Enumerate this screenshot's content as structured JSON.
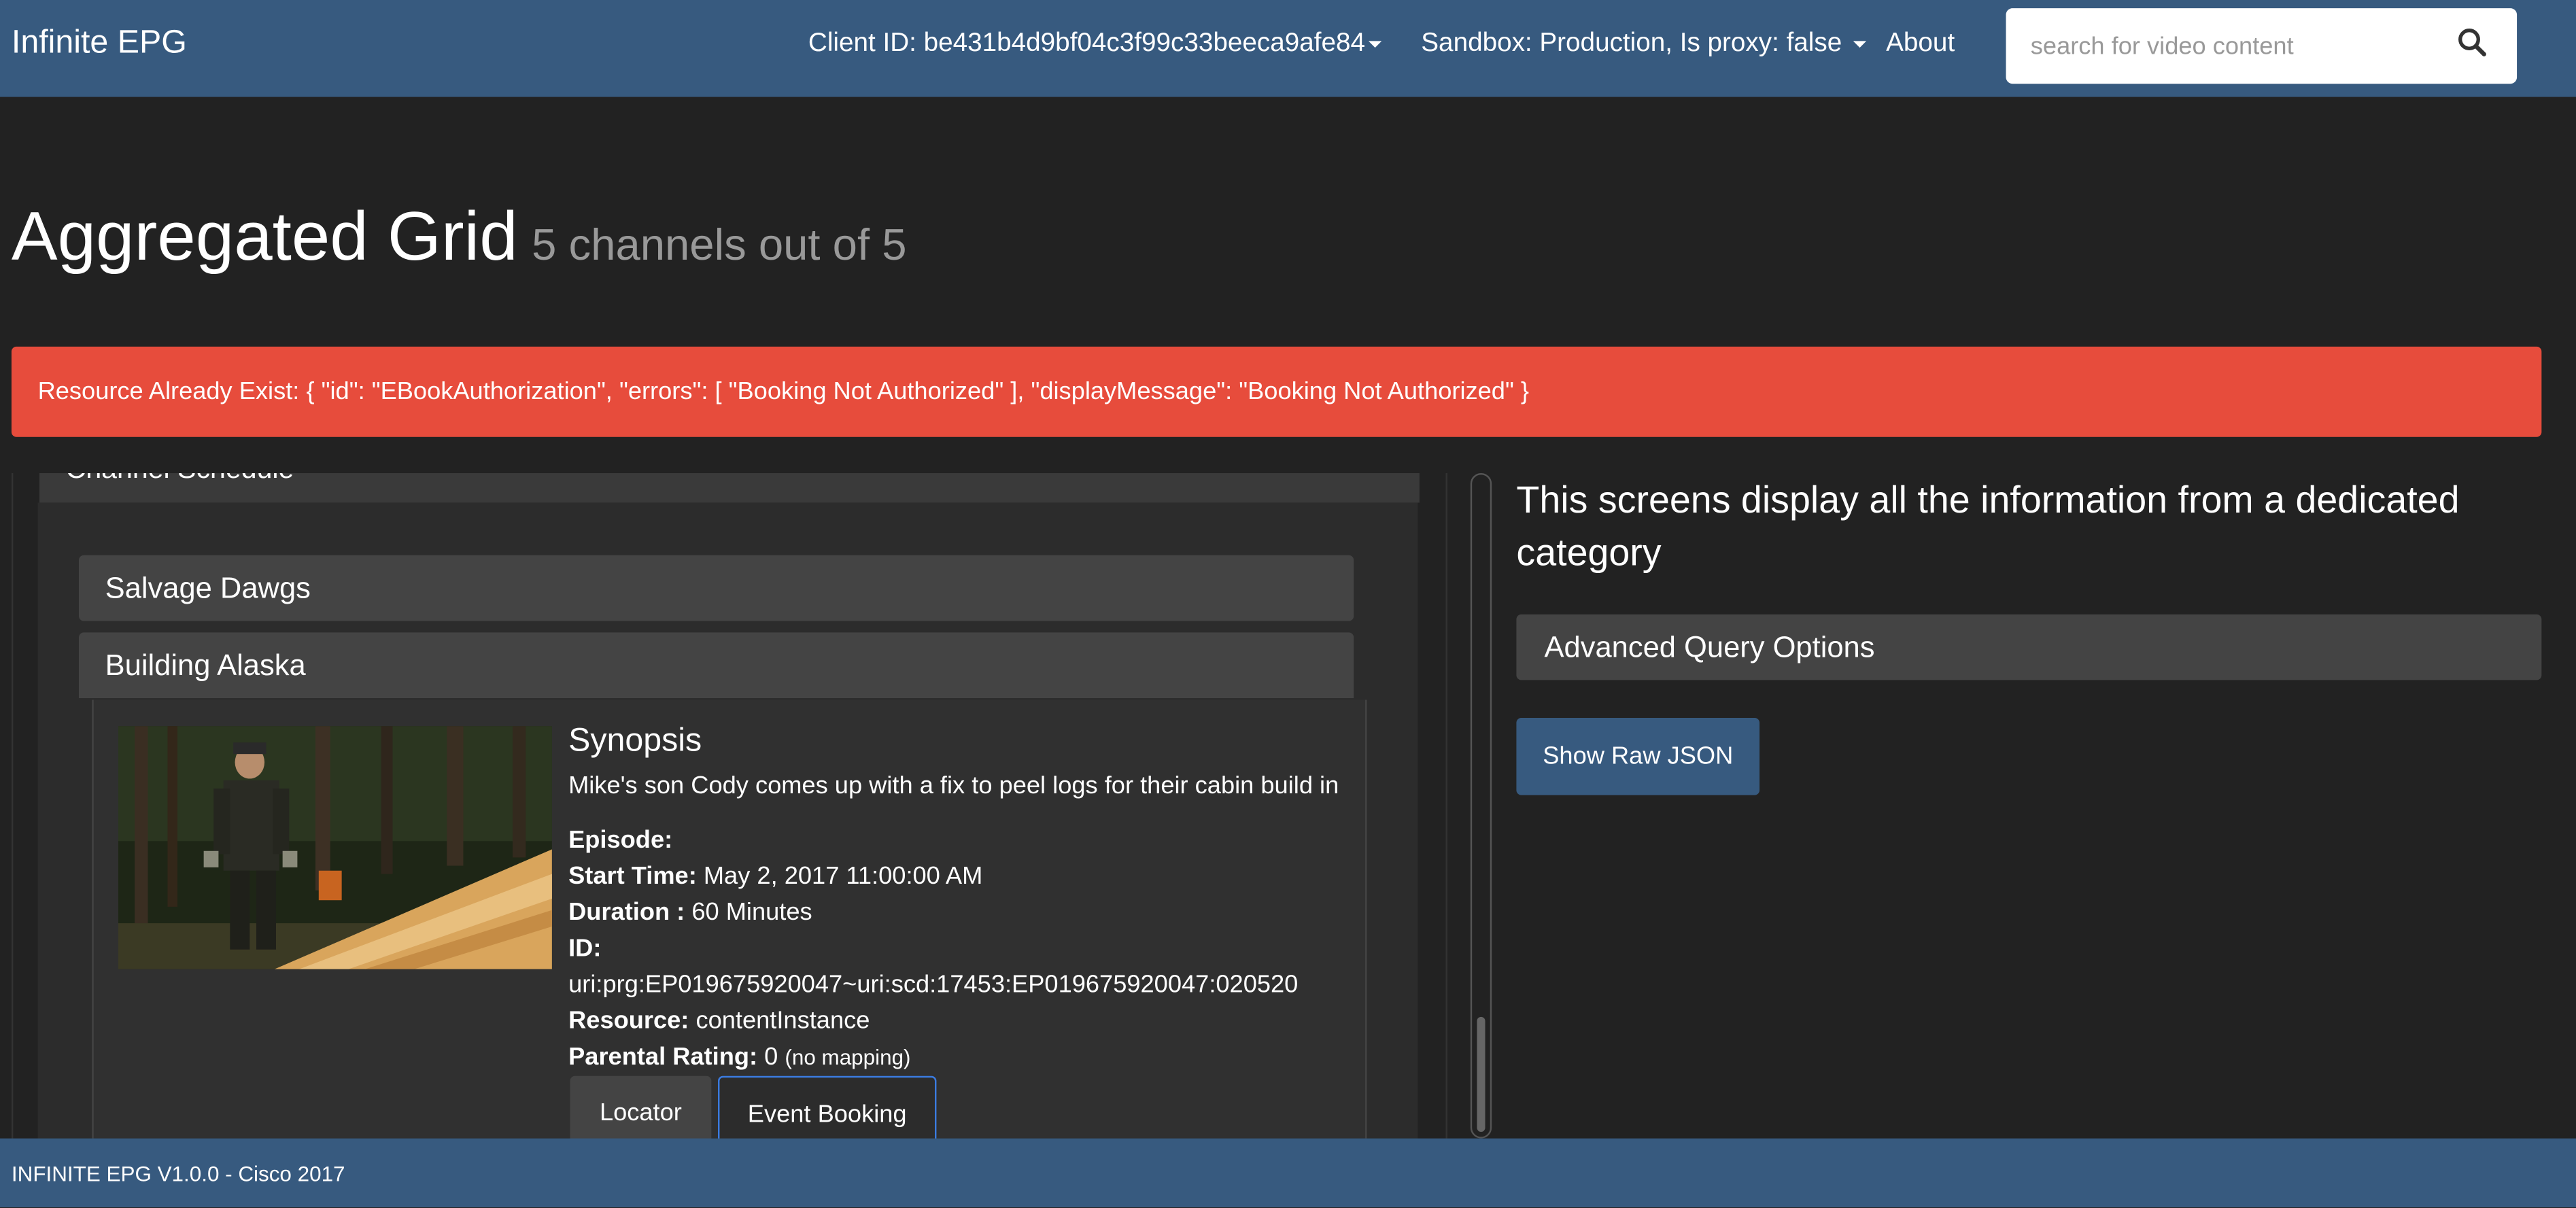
{
  "navbar": {
    "brand": "Infinite EPG",
    "client_id": "Client ID: be431b4d9bf04c3f99c33beeca9afe84",
    "sandbox": "Sandbox: Production, Is proxy: false",
    "about": "About",
    "search_placeholder": "search for video content",
    "search_value": ""
  },
  "page": {
    "title": "Aggregated Grid",
    "subtitle": "5 channels out of 5"
  },
  "alert": {
    "message": "Resource Already Exist: { \"id\": \"EBookAuthorization\", \"errors\": [ \"Booking Not Authorized\" ], \"displayMessage\": \"Booking Not Authorized\" }",
    "color": "#e74c3c"
  },
  "channel": {
    "header": "Channel Schedule",
    "programs": [
      {
        "title": "Salvage Dawgs"
      },
      {
        "title": "Building Alaska"
      }
    ],
    "detail": {
      "synopsis_heading": "Synopsis",
      "synopsis": "Mike's son Cody comes up with a fix to peel logs for their cabin build in",
      "episode_label": "Episode:",
      "start_time_label": "Start Time:",
      "start_time": "May 2, 2017 11:00:00 AM",
      "duration_label": "Duration :",
      "duration": "60 Minutes",
      "id_label": "ID:",
      "id": "uri:prg:EP019675920047~uri:scd:17453:EP019675920047:020520",
      "resource_label": "Resource:",
      "resource": "contentInstance",
      "parental_label": "Parental Rating:",
      "parental": "0",
      "parental_note": "(no mapping)",
      "locator_button": "Locator",
      "event_booking_button": "Event Booking"
    }
  },
  "right": {
    "heading": "This screens display all the information from a dedicated category",
    "advanced": "Advanced Query Options",
    "raw_json_button": "Show Raw JSON"
  },
  "footer": {
    "text": "INFINITE EPG V1.0.0 - Cisco 2017"
  },
  "colors": {
    "primary": "#375a7f",
    "background": "#222222",
    "danger": "#e74c3c",
    "focus": "#3b7be0"
  }
}
